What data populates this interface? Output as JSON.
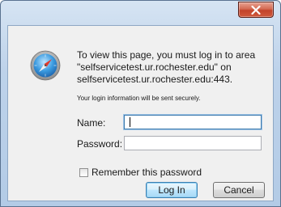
{
  "dialog": {
    "message_lines": [
      "To view this page, you must log in to area",
      "\"selfservicetest.ur.rochester.edu\" on",
      "selfservicetest.ur.rochester.edu:443."
    ],
    "secure_note": "Your login information will be sent securely.",
    "name_label": "Name:",
    "name_value": "",
    "password_label": "Password:",
    "password_value": "",
    "remember_label": "Remember this password",
    "remember_checked": false,
    "login_button": "Log In",
    "cancel_button": "Cancel",
    "close_glyph": "X"
  },
  "icons": {
    "app": "safari-compass-icon",
    "close": "close-icon"
  },
  "colors": {
    "close_button": "#c2422a",
    "title_bar": "#bdd2ea",
    "dialog_body": "#f0f0f0",
    "focus_border": "#3d7bad"
  }
}
